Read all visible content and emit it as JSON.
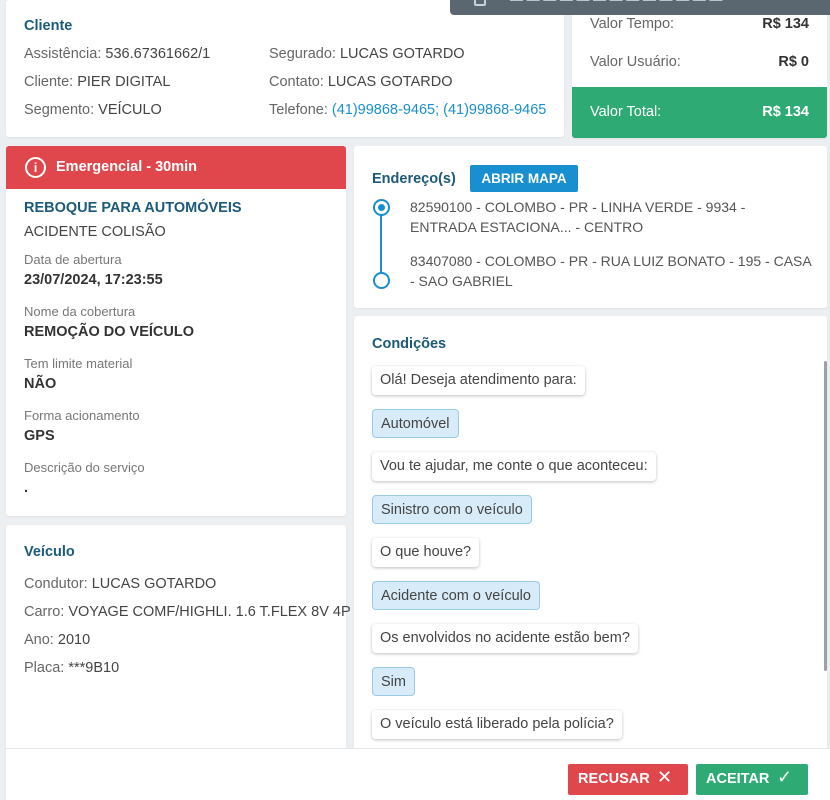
{
  "top_bar": {
    "text": "— — — — — — — — — — — — —"
  },
  "cliente": {
    "title": "Cliente",
    "assistencia_label": "Assistência:",
    "assistencia": "536.67361662/1",
    "cliente_label": "Cliente:",
    "cliente": "PIER DIGITAL",
    "segmento_label": "Segmento:",
    "segmento": "VEÍCULO",
    "segurado_label": "Segurado:",
    "segurado": "LUCAS GOTARDO",
    "contato_label": "Contato:",
    "contato": "LUCAS GOTARDO",
    "telefone_label": "Telefone:",
    "telefone": "(41)99868-9465; (41)99868-9465"
  },
  "valores": {
    "tempo_label": "Valor Tempo:",
    "tempo": "R$ 134",
    "usuario_label": "Valor Usuário:",
    "usuario": "R$ 0",
    "total_label": "Valor Total:",
    "total": "R$ 134",
    "colors": {
      "total_bg": "#2eaa74"
    }
  },
  "servico": {
    "emergency_label": "Emergencial - 30min",
    "info_icon": "info-icon",
    "title": "REBOQUE PARA AUTOMÓVEIS",
    "subtitle": "ACIDENTE COLISÃO",
    "fields": [
      {
        "label": "Data de abertura",
        "value": "23/07/2024, 17:23:55"
      },
      {
        "label": "Nome da cobertura",
        "value": "REMOÇÃO DO VEÍCULO"
      },
      {
        "label": "Tem limite material",
        "value": "NÃO"
      },
      {
        "label": "Forma acionamento",
        "value": "GPS"
      },
      {
        "label": "Descrição do serviço",
        "value": "."
      }
    ],
    "colors": {
      "emergency_bg": "#e0474c"
    }
  },
  "veiculo": {
    "title": "Veículo",
    "condutor_label": "Condutor:",
    "condutor": "LUCAS GOTARDO",
    "carro_label": "Carro:",
    "carro": "VOYAGE COMF/HIGHLI. 1.6 T.FLEX 8V 4P",
    "ano_label": "Ano:",
    "ano": "2010",
    "placa_label": "Placa:",
    "placa": "***9B10"
  },
  "endereco": {
    "title": "Endereço(s)",
    "map_button": "ABRIR MAPA",
    "addresses": [
      "82590100 - COLOMBO - PR - LINHA VERDE - 9934 - ENTRADA ESTACIONA... - CENTRO",
      "83407080 - COLOMBO - PR - RUA LUIZ BONATO - 195 - CASA - SAO GABRIEL"
    ]
  },
  "condicoes": {
    "title": "Condições",
    "messages": [
      {
        "type": "question",
        "text": "Olá! Deseja atendimento para:"
      },
      {
        "type": "answer",
        "text": "Automóvel"
      },
      {
        "type": "question",
        "text": "Vou te ajudar, me conte o que aconteceu:"
      },
      {
        "type": "answer",
        "text": "Sinistro com o veículo"
      },
      {
        "type": "question",
        "text": "O que houve?"
      },
      {
        "type": "answer",
        "text": "Acidente com o veículo"
      },
      {
        "type": "question",
        "text": "Os envolvidos no acidente estão bem?"
      },
      {
        "type": "answer",
        "text": "Sim"
      },
      {
        "type": "question",
        "text": "O veículo está liberado pela polícia?"
      }
    ]
  },
  "footer": {
    "recusar": "RECUSAR",
    "recusar_icon": "close-icon",
    "aceitar": "ACEITAR",
    "aceitar_icon": "check-icon",
    "colors": {
      "recusar": "#e0474c",
      "aceitar": "#2eaa74"
    }
  }
}
